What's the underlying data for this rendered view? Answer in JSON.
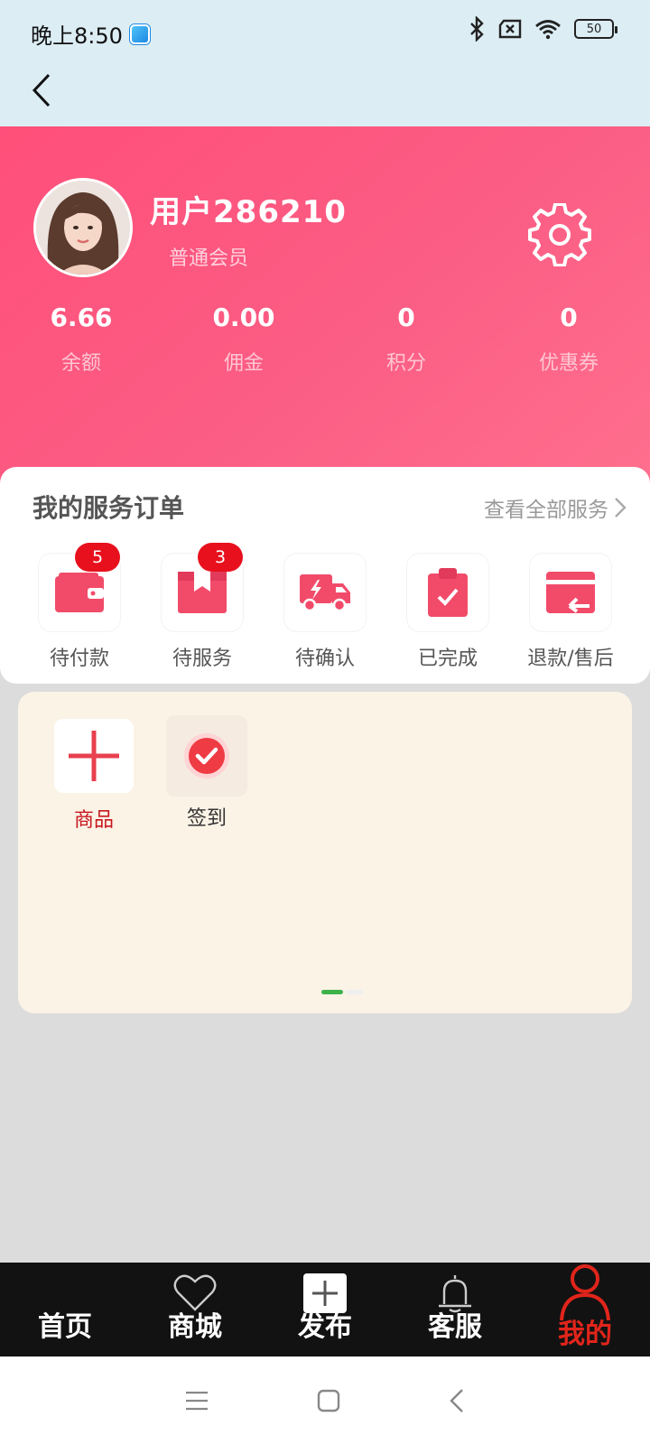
{
  "status": {
    "time": "晚上8:50",
    "battery": "50"
  },
  "profile": {
    "username": "用户286210",
    "level": "普通会员"
  },
  "stats": [
    {
      "value": "6.66",
      "label": "余额"
    },
    {
      "value": "0.00",
      "label": "佣金"
    },
    {
      "value": "0",
      "label": "积分"
    },
    {
      "value": "0",
      "label": "优惠券"
    }
  ],
  "orders": {
    "title": "我的服务订单",
    "more": "查看全部服务",
    "items": [
      {
        "label": "待付款",
        "badge": "5",
        "icon": "wallet-icon"
      },
      {
        "label": "待服务",
        "badge": "3",
        "icon": "box-icon"
      },
      {
        "label": "待确认",
        "icon": "truck-icon"
      },
      {
        "label": "已完成",
        "icon": "clipboard-check-icon"
      },
      {
        "label": "退款/售后",
        "icon": "refund-icon"
      }
    ]
  },
  "tools": [
    {
      "label": "商品",
      "icon": "plus-icon",
      "color": "#c8171e"
    },
    {
      "label": "签到",
      "icon": "check-circle-icon",
      "color": "#333333"
    }
  ],
  "nav": [
    {
      "label": "首页"
    },
    {
      "label": "商城",
      "icon": "heart-icon"
    },
    {
      "label": "发布",
      "icon": "plus-box-icon"
    },
    {
      "label": "客服",
      "icon": "bell-icon"
    },
    {
      "label": "我的",
      "icon": "user-icon",
      "active": true
    }
  ],
  "colors": {
    "accent": "#ff5079",
    "active": "#e1251b",
    "badge": "#e8101d"
  }
}
